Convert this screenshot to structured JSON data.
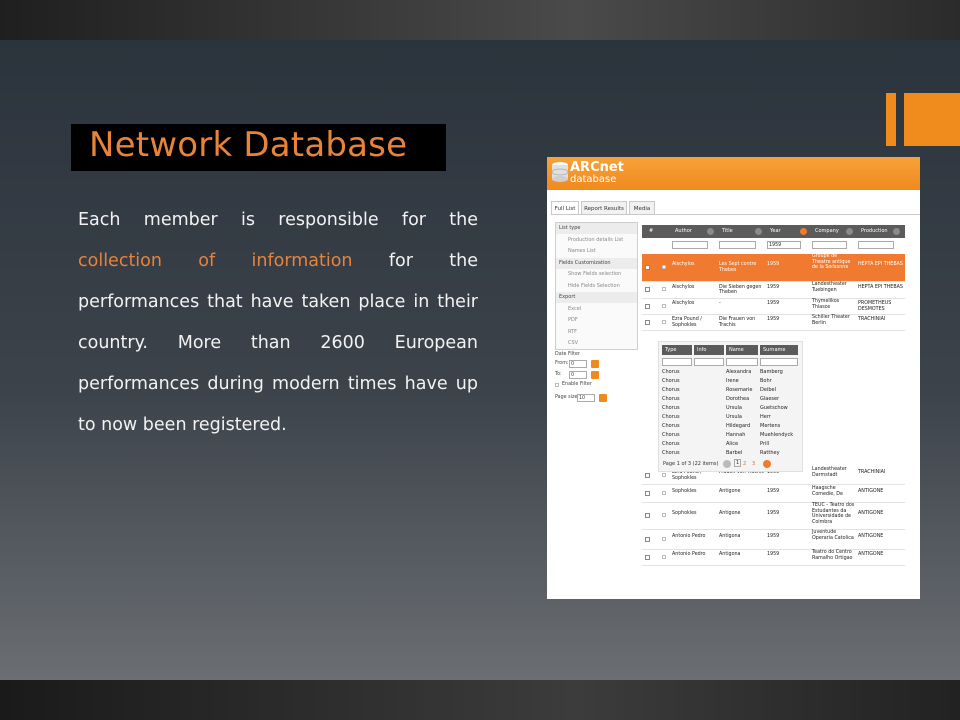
{
  "slide": {
    "title": "Network Database",
    "body_part1": "Each member is responsible for the ",
    "body_highlight": "collection of information",
    "body_part2": " for the performances that have taken place in their country. More than 2600 European performances during modern times have up to now been registered."
  },
  "colors": {
    "accent": "#ef8a1e",
    "title": "#e8833a",
    "selected_row": "#ef7a30",
    "grid_header": "#5b5b5b"
  },
  "app": {
    "logo_line1": "ARCnet",
    "logo_line2": "database",
    "tabs": [
      "Full List",
      "Report Results",
      "Media"
    ],
    "sidebar": [
      {
        "kind": "head",
        "label": "List type"
      },
      {
        "kind": "item",
        "label": "Production details List"
      },
      {
        "kind": "item",
        "label": "Names List"
      },
      {
        "kind": "head",
        "label": "Fields Customization"
      },
      {
        "kind": "item",
        "label": "Show Fields selection"
      },
      {
        "kind": "item",
        "label": "Hide Fields Selection"
      },
      {
        "kind": "head",
        "label": "Export"
      },
      {
        "kind": "item",
        "label": "Excel"
      },
      {
        "kind": "item",
        "label": "PDF"
      },
      {
        "kind": "item",
        "label": "RTF"
      },
      {
        "kind": "item",
        "label": "CSV"
      }
    ],
    "date_filter": {
      "label": "Date Filter",
      "from_label": "From:",
      "from_value": "0",
      "to_label": "To:",
      "to_value": "0",
      "enable_label": "Enable Filter",
      "page_size_label": "Page size:",
      "page_size_value": "10"
    },
    "grid": {
      "columns": [
        "#",
        "Author",
        "Title",
        "Year",
        "Company",
        "Production"
      ],
      "year_filter": "1959",
      "rows": [
        {
          "author": "Aischylos",
          "title": "Les Sept contre Thebes",
          "year": "1959",
          "company": "Groupe de Theatre antique de la Sorbonne",
          "production": "HEPTA EPI THEBAS",
          "selected": true
        },
        {
          "author": "Aischylos",
          "title": "Die Sieben gegen Theben",
          "year": "1959",
          "company": "Landestheater Tuebingen",
          "production": "HEPTA EPI THEBAS"
        },
        {
          "author": "Aischylos",
          "title": "-",
          "year": "1959",
          "company": "Thymelikos Thiasos",
          "production": "PROMETHEUS DESMOTES"
        },
        {
          "author": "Ezra Pound / Sophokles",
          "title": "Die Frauen von Trachis",
          "year": "1959",
          "company": "Schiller Theater Berlin",
          "production": "TRACHINIAI",
          "expanded": true
        },
        {
          "author": "Ezra Pound / Sophokles",
          "title": "Frauen von Trachis",
          "year": "1959",
          "company": "Landestheater Darmstadt",
          "production": "TRACHINIAI"
        },
        {
          "author": "Sophokles",
          "title": "Antigone",
          "year": "1959",
          "company": "Haagsche Comedie, De",
          "production": "ANTIGONE"
        },
        {
          "author": "Sophokles",
          "title": "Antigone",
          "year": "1959",
          "company": "TEUC - Teatro dos Estudantes da Universidade de Coimbra",
          "production": "ANTIGONE"
        },
        {
          "author": "Antonio Pedro",
          "title": "Antigona",
          "year": "1959",
          "company": "Juventude Operaria Catolica",
          "production": "ANTIGONE"
        },
        {
          "author": "Antonio Pedro",
          "title": "Antigona",
          "year": "1959",
          "company": "Teatro do Centro Ramalho Ortigao",
          "production": "ANTIGONE"
        }
      ]
    },
    "subgrid": {
      "columns": [
        "Type",
        "Info",
        "Name",
        "Surname"
      ],
      "rows": [
        [
          "Chorus",
          "",
          "Alexandra",
          "Bamberg"
        ],
        [
          "Chorus",
          "",
          "Irene",
          "Bohr"
        ],
        [
          "Chorus",
          "",
          "Rosemarie",
          "Deibel"
        ],
        [
          "Chorus",
          "",
          "Dorothea",
          "Glaeser"
        ],
        [
          "Chorus",
          "",
          "Ursula",
          "Guetschow"
        ],
        [
          "Chorus",
          "",
          "Ursula",
          "Herr"
        ],
        [
          "Chorus",
          "",
          "Hildegard",
          "Mertens"
        ],
        [
          "Chorus",
          "",
          "Hannah",
          "Muehlendyck"
        ],
        [
          "Chorus",
          "",
          "Alice",
          "Prill"
        ],
        [
          "Chorus",
          "",
          "Barbel",
          "Ratthey"
        ]
      ],
      "pager_text": "Page 1 of 3 (22 items)",
      "pages": [
        "1",
        "2",
        "3"
      ]
    }
  }
}
